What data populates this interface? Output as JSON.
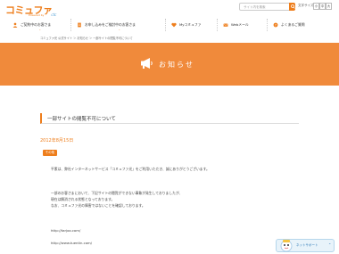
{
  "header": {
    "logo_text": "コミュファ",
    "logo_sub": "Powered by",
    "logo_cite": "ctc",
    "search_placeholder": "サイト内を検索",
    "font_size_label": "文字サイズ",
    "font_sizes": [
      "小",
      "中",
      "大"
    ]
  },
  "nav": {
    "items": [
      {
        "label": "ご契約中のお客さま",
        "icon": "user-icon"
      },
      {
        "label": "お申し込みをご検討中のお客さま",
        "icon": "document-icon"
      },
      {
        "label": "Myコミュファ",
        "icon": "heart-icon"
      },
      {
        "label": "Webメール",
        "icon": "mail-icon"
      },
      {
        "label": "よくあるご質問",
        "icon": "question-icon"
      }
    ]
  },
  "breadcrumb": "コミュファ光 公式サイト ＞ お知らせ ＞ 一部サイトの閲覧不可について",
  "banner": {
    "title": "お知らせ",
    "icon": "megaphone-icon",
    "color": "#f08a3b"
  },
  "article": {
    "title": "一部サイトの閲覧不可について",
    "date": "2012年8月15日",
    "badge": "その他",
    "lines": [
      "平素は、弊社インターネットサービス「コミュファ光」をご利用いただき、誠にありがとうございます。",
      "一部のお客さまにおいて、下記サイトの閲覧ができない事象が発生しておりましたが、",
      "現在は解消される状態となっております。",
      "なお、コミュファ光の障害ではないことを確認しております。",
      "http://tarjoo.com/",
      "http://www.tuentin.com/"
    ]
  },
  "widget": {
    "label": "ネットサポート",
    "icon": "support-character-icon"
  },
  "colors": {
    "accent": "#ee7e1c",
    "banner": "#f08a3b",
    "widget_text": "#2b78b6"
  }
}
